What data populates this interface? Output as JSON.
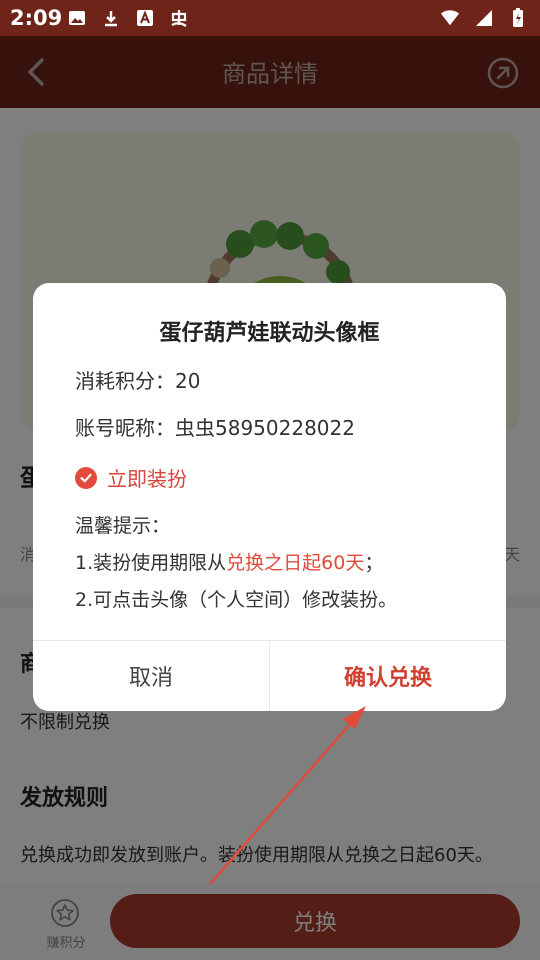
{
  "status_bar": {
    "time": "2:09"
  },
  "nav": {
    "title": "商品详情"
  },
  "product": {
    "name_partial": "蛋",
    "meta_left": "消",
    "meta_right": "天"
  },
  "sections": {
    "limit_title_partial": "商",
    "limit_text": "不限制兑换",
    "rules_title": "发放规则",
    "rules_text": "兑换成功即发放到账户。装扮使用期限从兑换之日起60天。"
  },
  "bottom_bar": {
    "earn_label": "赚积分",
    "exchange_label": "兑换"
  },
  "dialog": {
    "title": "蛋仔葫芦娃联动头像框",
    "cost_line": "消耗积分：20",
    "nickname_line": "账号昵称：虫虫58950228022",
    "wear_now": "立即装扮",
    "tips_title": "温馨提示：",
    "tip1_prefix": "1.装扮使用期限从",
    "tip1_highlight": "兑换之日起60天",
    "tip1_suffix": "；",
    "tip2": "2.可点击头像（个人空间）修改装扮。",
    "cancel": "取消",
    "confirm": "确认兑换"
  },
  "colors": {
    "header": "#6e2418",
    "accent": "#d1402f",
    "button": "#a93a2c"
  }
}
